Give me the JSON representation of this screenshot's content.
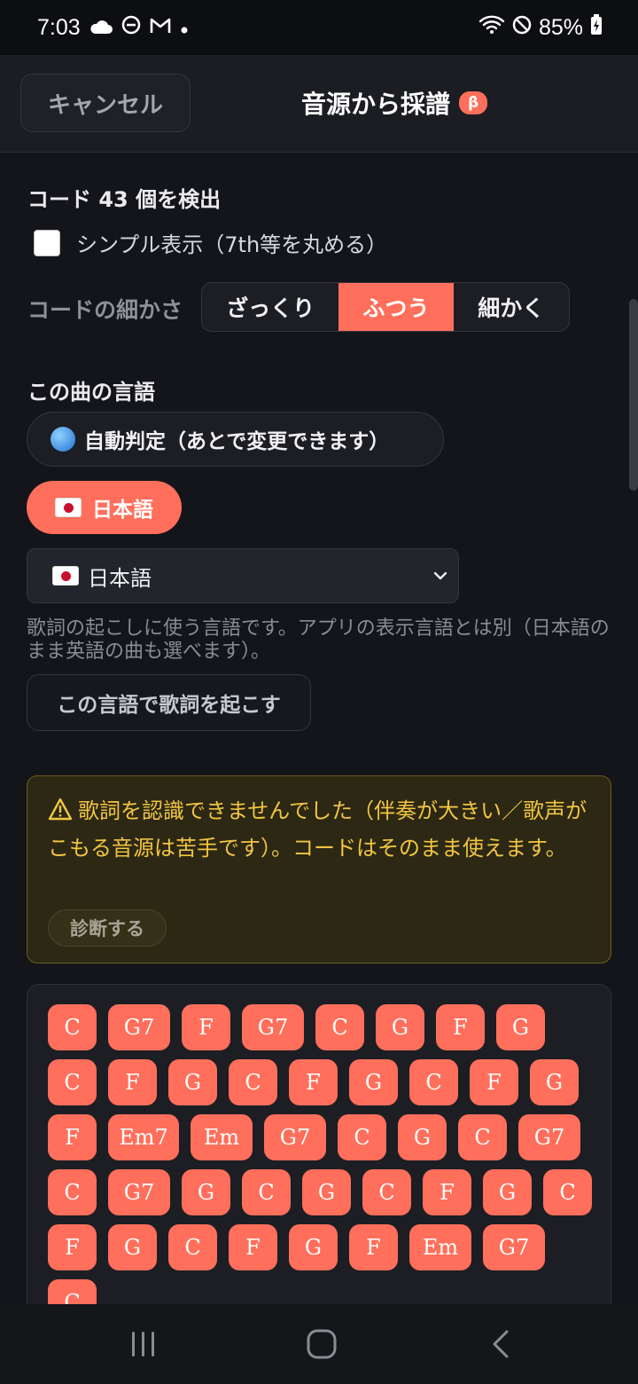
{
  "status_bar": {
    "time": "7:03",
    "battery": "85%"
  },
  "header": {
    "cancel_label": "キャンセル",
    "title": "音源から採譜",
    "badge": "β"
  },
  "detect": {
    "heading": "コード 43 個を検出",
    "simple_label": "シンプル表示（7th等を丸める）",
    "simple_checked": false
  },
  "granularity": {
    "label": "コードの細かさ",
    "options": [
      "ざっくり",
      "ふつう",
      "細かく"
    ],
    "selected": "ふつう"
  },
  "language": {
    "heading": "この曲の言語",
    "auto_label": "自動判定（あとで変更できます）",
    "selected_pill": "日本語",
    "select_value": "日本語",
    "help": "歌詞の起こしに使う言語です。アプリの表示言語とは別（日本語のまま英語の曲も選べます）。",
    "transcribe_button": "この言語で歌詞を起こす"
  },
  "warning": {
    "text": "歌詞を認識できませんでした（伴奏が大きい／歌声がこもる音源は苦手です）。コードはそのまま使えます。",
    "diagnose_button": "診断する"
  },
  "chords": [
    "C",
    "G7",
    "F",
    "G7",
    "C",
    "G",
    "F",
    "G",
    "C",
    "F",
    "G",
    "C",
    "F",
    "G",
    "C",
    "F",
    "G",
    "F",
    "Em7",
    "Em",
    "G7",
    "C",
    "G",
    "C",
    "G7",
    "C",
    "G7",
    "G",
    "C",
    "G",
    "C",
    "F",
    "G",
    "C",
    "F",
    "G",
    "C",
    "F",
    "G",
    "F",
    "Em",
    "G7",
    "C"
  ],
  "colors": {
    "accent": "#ff6f5b",
    "warning": "#f2c542",
    "background": "#13151a"
  }
}
